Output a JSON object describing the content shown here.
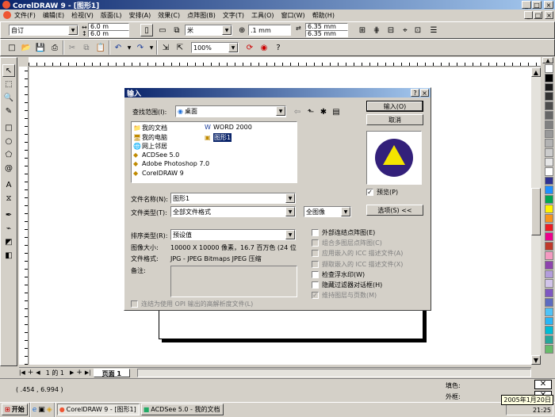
{
  "title": "CorelDRAW 9 - [图形1]",
  "win_ctrl": [
    "_",
    "□",
    "×"
  ],
  "doc_ctrl": [
    "_",
    "□",
    "×"
  ],
  "menu": [
    "文件(F)",
    "编辑(E)",
    "检视(V)",
    "版面(L)",
    "安排(A)",
    "效果(C)",
    "点阵图(B)",
    "文字(T)",
    "工具(O)",
    "窗口(W)",
    "帮助(H)"
  ],
  "prop": {
    "preset": "自订",
    "w": "6.0 m",
    "h": "6.0 m",
    "unit": "米",
    "nudge": ".1 mm",
    "dx": "6.35 mm",
    "dy": "6.35 mm"
  },
  "std": {
    "zoom": "100%"
  },
  "pager": {
    "count": "1 的 1",
    "tab": "页面  1"
  },
  "status": {
    "coords": "( .454 , 6.994 )",
    "fill": "填色:",
    "outline": "外框:"
  },
  "taskbar": {
    "start": "开始",
    "t1": "CorelDRAW 9 - [图形1]",
    "t2": "ACDSee 5.0 - 我的文档",
    "date": "2005年1月20日",
    "time": "21:25"
  },
  "dialog": {
    "title": "输入",
    "lookin_label": "查找范围(I):",
    "lookin_value": "桌面",
    "files": [
      "我的文档",
      "我的电脑",
      "网上邻居",
      "ACDSee 5.0",
      "Adobe Photoshop 7.0",
      "CorelDRAW 9",
      "WORD 2000",
      "图形1"
    ],
    "filename_label": "文件名称(N):",
    "filename_value": "图形1",
    "filetype_label": "文件类型(T):",
    "filetype_value": "全部文件格式",
    "image_sel": "全图像",
    "sort_label": "排序类型(R):",
    "sort_value": "预设值",
    "size_label": "图像大小:",
    "size_value": "10000 X 10000 像素，16.7 百万色 (24 位",
    "format_label": "文件格式:",
    "format_value": "JPG - JPEG Bitmaps JPEG 压缩",
    "notes_label": "备注:",
    "ok": "输入(O)",
    "cancel": "取消",
    "preview": "预览(P)",
    "options": "选项(S) <<",
    "opts": [
      {
        "label": "外部连结点阵图(E)",
        "enabled": true
      },
      {
        "label": "组合多图层点阵图(C)",
        "enabled": false
      },
      {
        "label": "应用嵌入的 ICC 描述文件(A)",
        "enabled": false
      },
      {
        "label": "撷取嵌入的 ICC 描述文件(X)",
        "enabled": false
      },
      {
        "label": "检查浮水印(W)",
        "enabled": true
      },
      {
        "label": "隐藏过滤器对话框(H)",
        "enabled": true
      },
      {
        "label": "维持图层与页数(M)",
        "enabled": false,
        "checked": true
      }
    ],
    "bottom_opt": "连结为使用 OPI 输出的高解析度文件(L)",
    "help": "?",
    "close": "×"
  },
  "palette": [
    "#ffffff",
    "#000000",
    "#1a1a1a",
    "#333333",
    "#4d4d4d",
    "#666666",
    "#808080",
    "#999999",
    "#b3b3b3",
    "#cccccc",
    "#e6e6e6",
    "#ffffff",
    "#2e3192",
    "#1e90ff",
    "#00a651",
    "#fff200",
    "#f7941d",
    "#ed1c24",
    "#ec008c",
    "#c0392b",
    "#f49ac1",
    "#8e44ad",
    "#b39ddb",
    "#d1c4e9",
    "#7e57c2",
    "#5c6bc0",
    "#4fc3f7",
    "#29b6f6",
    "#00bcd4",
    "#26a69a",
    "#66bb6a"
  ]
}
